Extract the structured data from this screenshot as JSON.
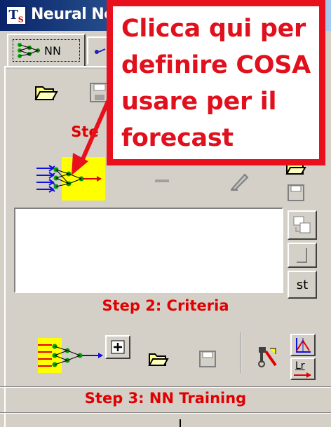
{
  "window": {
    "title": "Neural Ne",
    "logo_text": "T",
    "logo_sub": "S"
  },
  "tabs": [
    {
      "label": "NN",
      "icon": "network-icon"
    },
    {
      "label": "",
      "icon": "dot-icon"
    }
  ],
  "toolbar1": {
    "icons": [
      "open-folder-icon",
      "save-icon"
    ]
  },
  "step1": {
    "label": "Ste",
    "icons": [
      "neural-network-icon",
      "minus-icon",
      "eraser-icon",
      "open-folder-icon",
      "save-icon"
    ]
  },
  "step2": {
    "label": "Step 2: Criteria",
    "side_buttons": [
      {
        "icon": "copy-icon"
      },
      {
        "icon": "blank-icon"
      },
      {
        "label": "st"
      }
    ],
    "icons": [
      "neural-network-icon",
      "plus-icon",
      "open-folder-icon",
      "save-icon",
      "tools-icon",
      "chart-icon",
      "learning-rate-icon"
    ],
    "lr_label": "Lr"
  },
  "step3": {
    "label": "Step 3: NN Training"
  },
  "callout": {
    "lines": [
      "Clicca qui per",
      "definire COSA",
      "usare per il",
      "forecast"
    ],
    "color": "#e8101c"
  },
  "colors": {
    "accent": "#e00000",
    "highlight": "#ffff00",
    "face": "#d4d0c8"
  }
}
